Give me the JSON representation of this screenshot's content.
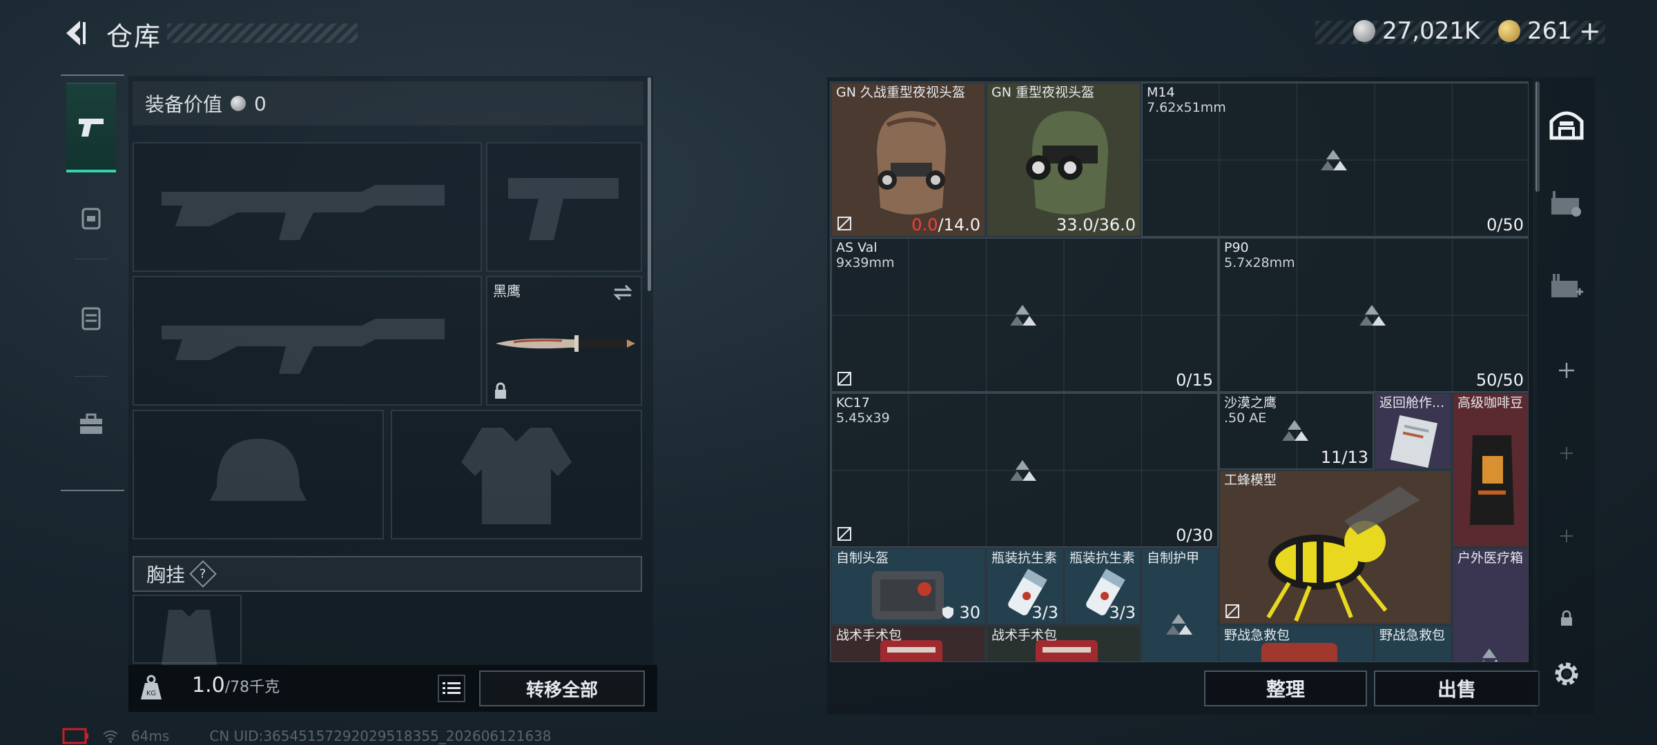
{
  "header": {
    "title": "仓库",
    "currency_silver": "27,021K",
    "currency_gold": "261",
    "add_label": "+"
  },
  "loadout": {
    "equipment_value_label": "装备价值",
    "equipment_value": "0",
    "melee_name": "黑鹰",
    "chest_rig_label": "胸挂",
    "help_label": "?",
    "weight_current": "1.0",
    "weight_max": "/78千克",
    "transfer_all": "转移全部"
  },
  "storage": {
    "items": [
      {
        "name": "GN 久战重型夜视头盔",
        "count_red": "0.0",
        "count": "/14.0"
      },
      {
        "name": "GN 重型夜视头盔",
        "count": "33.0/36.0"
      },
      {
        "name": "M14",
        "sub": "7.62x51mm",
        "count": "0/50"
      },
      {
        "name": "AS Val",
        "sub": "9x39mm",
        "count": "0/15"
      },
      {
        "name": "P90",
        "sub": "5.7x28mm",
        "count": "50/50"
      },
      {
        "name": "KC17",
        "sub": "5.45x39",
        "count": "0/30"
      },
      {
        "name": "沙漠之鹰",
        "sub": ".50 AE",
        "count": "11/13"
      },
      {
        "name": "返回舱作..."
      },
      {
        "name": "高级咖啡豆"
      },
      {
        "name": "工蜂模型"
      },
      {
        "name": "自制头盔",
        "count": "30"
      },
      {
        "name": "瓶装抗生素",
        "count": "3/3"
      },
      {
        "name": "瓶装抗生素",
        "count": "3/3"
      },
      {
        "name": "自制护甲"
      },
      {
        "name": "户外医疗箱"
      },
      {
        "name": "战术手术包"
      },
      {
        "name": "战术手术包"
      },
      {
        "name": "野战急救包"
      },
      {
        "name": "野战急救包"
      }
    ],
    "sort_label": "整理",
    "sell_label": "出售"
  },
  "status": {
    "ping": "64ms",
    "uid": "CN UID:3654515729202951​8355_202606121638"
  },
  "colors": {
    "accent": "#36d3a8",
    "brown_slot": "#4a3a30",
    "blue_slot": "#24404e",
    "purple_slot": "#3a3550",
    "red_slot": "#5a2a30"
  }
}
